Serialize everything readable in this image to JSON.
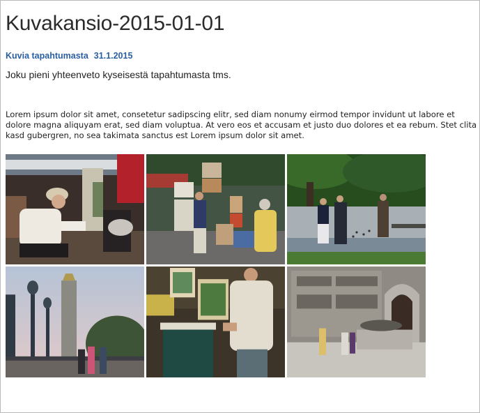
{
  "page": {
    "title": "Kuvakansio-2015-01-01"
  },
  "post": {
    "category_link": "Kuvia tapahtumasta",
    "date": "31.1.2015",
    "summary": "Joku pieni yhteenveto kyseisestä tapahtumasta tms.",
    "body": "Lorem ipsum dolor sit amet, consetetur sadipscing elitr, sed diam nonumy eirmod tempor invidunt ut labore et dolore magna aliquyam erat, sed diam voluptua. At vero eos et accusam et justo duo dolores et ea rebum. Stet clita kasd gubergren, no sea takimata sanctus est Lorem ipsum dolor sit amet."
  },
  "gallery": {
    "photos": [
      {
        "id": "photo-1"
      },
      {
        "id": "photo-2"
      },
      {
        "id": "photo-3"
      },
      {
        "id": "photo-4"
      },
      {
        "id": "photo-5"
      },
      {
        "id": "photo-6"
      }
    ]
  },
  "colors": {
    "link": "#2a5fa0",
    "title": "#2b2b2b",
    "border": "#b9b9b9"
  }
}
